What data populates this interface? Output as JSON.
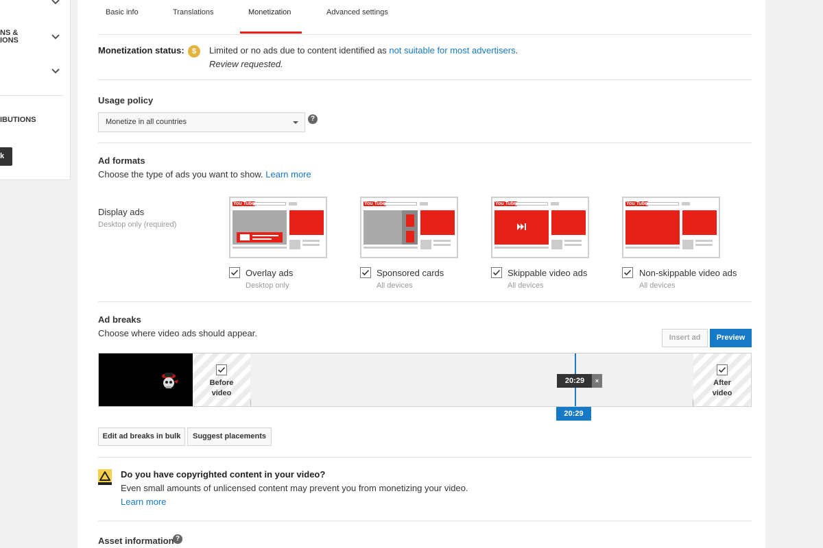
{
  "left_panel": {
    "item_1_line_1": "NS &",
    "item_1_line_2": "IONS",
    "item_2": "IBUTIONS",
    "button_label": "k"
  },
  "tabs": [
    {
      "label": "Basic info"
    },
    {
      "label": "Translations"
    },
    {
      "label": "Monetization",
      "active": true
    },
    {
      "label": "Advanced settings"
    }
  ],
  "monetization": {
    "status_label": "Monetization status:",
    "status_icon": "$",
    "status_text": "Limited or no ads due to content identified as ",
    "status_link": "not suitable for most advertisers",
    "status_text_end": ".",
    "status_sub": "Review requested."
  },
  "usage_policy": {
    "title": "Usage policy",
    "selected": "Monetize in all countries",
    "help_icon": "?"
  },
  "ad_formats": {
    "title": "Ad formats",
    "description": "Choose the type of ads you want to show. ",
    "learn_more": "Learn more",
    "display_ads_label": "Display ads",
    "display_ads_sub": "Desktop only (required)",
    "options": [
      {
        "label": "Overlay ads",
        "sub": "Desktop only",
        "checked": true
      },
      {
        "label": "Sponsored cards",
        "sub": "All devices",
        "checked": true
      },
      {
        "label": "Skippable video ads",
        "sub": "All devices",
        "checked": true
      },
      {
        "label": "Non-skippable video ads",
        "sub": "All devices",
        "checked": true
      }
    ],
    "logo_text": "You",
    "logo_badge": "Tube"
  },
  "ad_breaks": {
    "title": "Ad breaks",
    "description": "Choose where video ads should appear.",
    "insert_ad": "Insert ad",
    "preview": "Preview",
    "before_video_line_1": "Before",
    "before_video_line_2": "video",
    "after_video_line_1": "After",
    "after_video_line_2": "video",
    "marker_time": "20:29",
    "marker_close": "×",
    "pill_time": "20:29",
    "edit_bulk": "Edit ad breaks in bulk",
    "suggest": "Suggest placements"
  },
  "copyright": {
    "title": "Do you have copyrighted content in your video?",
    "description": "Even small amounts of unlicensed content may prevent you from monetizing your video.",
    "learn_more": "Learn more"
  },
  "asset": {
    "title": "Asset information",
    "help_icon": "?"
  },
  "colors": {
    "accent_red": "#e62117",
    "link_blue": "#167ac6",
    "coin_gold": "#e3b33c",
    "warning_yellow": "#f7d04b"
  }
}
